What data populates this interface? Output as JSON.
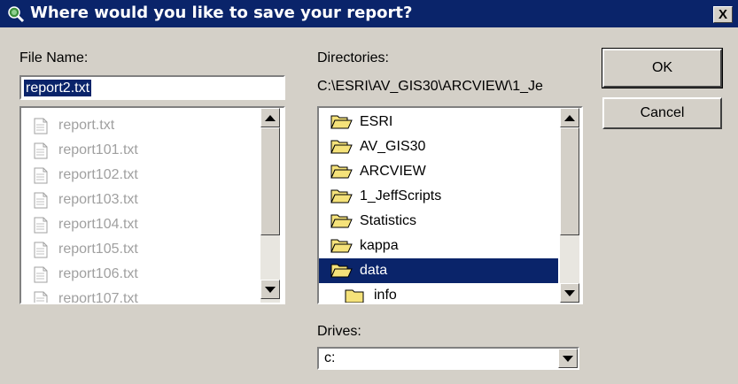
{
  "window": {
    "title": "Where would you like to save your report?",
    "close_glyph": "X"
  },
  "file_name": {
    "label": "File Name:",
    "value": "report2.txt"
  },
  "files": [
    {
      "name": "report.txt",
      "icon": "document-icon"
    },
    {
      "name": "report101.txt",
      "icon": "document-icon"
    },
    {
      "name": "report102.txt",
      "icon": "document-icon"
    },
    {
      "name": "report103.txt",
      "icon": "document-icon"
    },
    {
      "name": "report104.txt",
      "icon": "document-icon"
    },
    {
      "name": "report105.txt",
      "icon": "document-icon"
    },
    {
      "name": "report106.txt",
      "icon": "document-icon"
    },
    {
      "name": "report107.txt",
      "icon": "document-icon"
    }
  ],
  "directories": {
    "label": "Directories:",
    "path": "C:\\ESRI\\AV_GIS30\\ARCVIEW\\1_Je",
    "items": [
      {
        "name": "ESRI",
        "icon": "open-folder-icon"
      },
      {
        "name": "AV_GIS30",
        "icon": "open-folder-icon"
      },
      {
        "name": "ARCVIEW",
        "icon": "open-folder-icon"
      },
      {
        "name": "1_JeffScripts",
        "icon": "open-folder-icon"
      },
      {
        "name": "Statistics",
        "icon": "open-folder-icon"
      },
      {
        "name": "kappa",
        "icon": "open-folder-icon"
      },
      {
        "name": "data",
        "icon": "open-folder-icon"
      },
      {
        "name": "info",
        "icon": "closed-folder-icon"
      }
    ],
    "selected": "data"
  },
  "drives": {
    "label": "Drives:",
    "value": "c:"
  },
  "buttons": {
    "ok": "OK",
    "cancel": "Cancel"
  },
  "colors": {
    "title_bar": "#0a246a",
    "selection": "#0a246a",
    "dialog_bg": "#d4d0c8",
    "disabled_text": "#a0a0a0",
    "folder": "#f5e27a"
  }
}
